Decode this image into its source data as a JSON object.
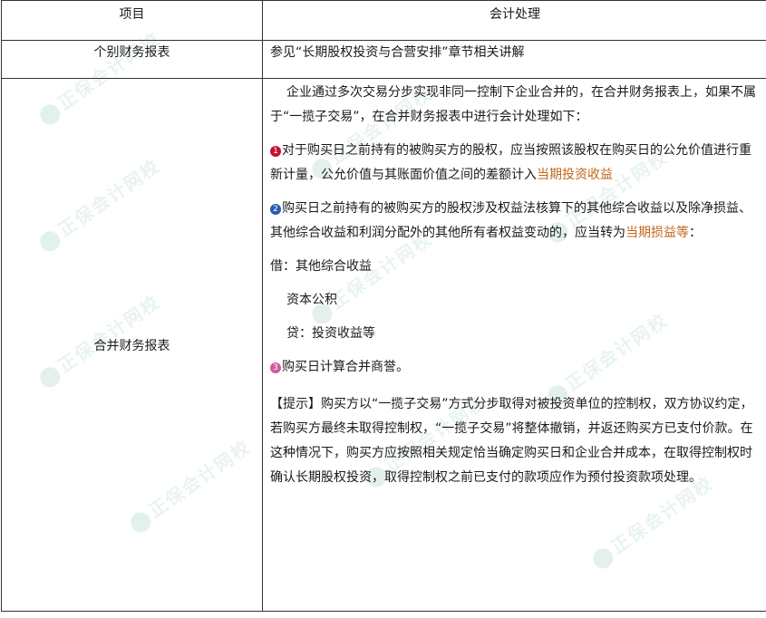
{
  "header": {
    "col1": "项目",
    "col2": "会计处理"
  },
  "row1": {
    "label": "个别财务报表",
    "content": "参见“长期股权投资与合营安排”章节相关讲解"
  },
  "row2": {
    "label": "合并财务报表",
    "intro": "企业通过多次交易分步实现非同一控制下企业合并的，在合并财务报表上，如果不属于“一揽子交易”，在合并财务报表中进行会计处理如下：",
    "item1": {
      "num": "1",
      "color": "#c8102e",
      "text": "对于购买日之前持有的被购买方的股权，应当按照该股权在购买日的公允价值进行重新计量，公允价值与其账面价值之间的差额计入",
      "highlight": "当期投资收益"
    },
    "item2": {
      "num": "2",
      "color": "#2a5db0",
      "text": "购买日之前持有的被购买方的股权涉及权益法核算下的其他综合收益以及除净损益、其他综合收益和利润分配外的其他所有者权益变动的，应当转为",
      "highlight": "当期损益等",
      "tail": "："
    },
    "entry1": "借：其他综合收益",
    "entry2": "资本公积",
    "entry3": "贷：投资收益等",
    "item3": {
      "num": "3",
      "color": "#d05aa0",
      "text": "购买日计算合并商誉。"
    },
    "tip": "【提示】购买方以“一揽子交易”方式分步取得对被投资单位的控制权，双方协议约定， 若购买方最终未取得控制权，“一揽子交易”将整体撤销，并返还购买方已支付价款。在这种情况下，购买方应按照相关规定恰当确定购买日和企业合并成本，在取得控制权时确认长期股权投资，取得控制权之前已支付的款项应作为预付投资款项处理。"
  },
  "watermark": "正保会计网校"
}
